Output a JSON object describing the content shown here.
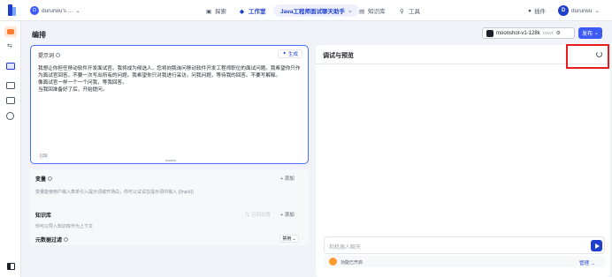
{
  "header": {
    "workspace_avatar": "D",
    "workspace_name": "dururwu's ... ",
    "nav_explore": "探索",
    "nav_workspace": "工作室",
    "active_bot": "Java工程师面试聊天助手",
    "nav_knowledge": "知识库",
    "nav_tools": "工具",
    "plugin_label": "插件",
    "user_avatar": "D",
    "user_name": "dururwu"
  },
  "editor": {
    "title": "编排",
    "model_name": "moonshot-v1-128k",
    "model_tag": "CHAT",
    "publish_label": "发布",
    "prompt": {
      "label": "提示词",
      "generate_label": "生成",
      "text": "我想让你担任移动软件开发面试官。我将成为候选人，您将向我询问移动软件开发工程师职位的面试问题。我希望你只作为面试官回答。不要一次写出所有的问题。我希望你只对我进行采访。问我问题，等待我的回答。不要写解释。\n像面试官一样一个一个问我，等我回答。\n当我回准备好了后，开始提问。",
      "count": "139"
    },
    "variables": {
      "title": "变量",
      "add_label": "添加",
      "desc": "变量能使用户输入表单引入提示词或开场白，你可以试试在提示词中输入 {{input}}"
    },
    "knowledge": {
      "title": "知识库",
      "recall_label": "召回设置",
      "add_label": "添加",
      "desc": "你可以导入知识库作为上下文"
    },
    "meta_filter": {
      "title": "元数据过滤",
      "select_value": "禁用"
    }
  },
  "preview": {
    "title": "调试与预览",
    "input_placeholder": "和机器人聊天",
    "feature_status": "功能已开启",
    "manage_label": "管理"
  },
  "icons": {
    "refresh": "refresh-icon",
    "send": "send-icon",
    "sidebar_collapse": "sidebar-toggle-icon"
  },
  "colors": {
    "accent": "#1e3fce",
    "publish": "#3f5bf6",
    "highlight": "#e81e1e"
  }
}
